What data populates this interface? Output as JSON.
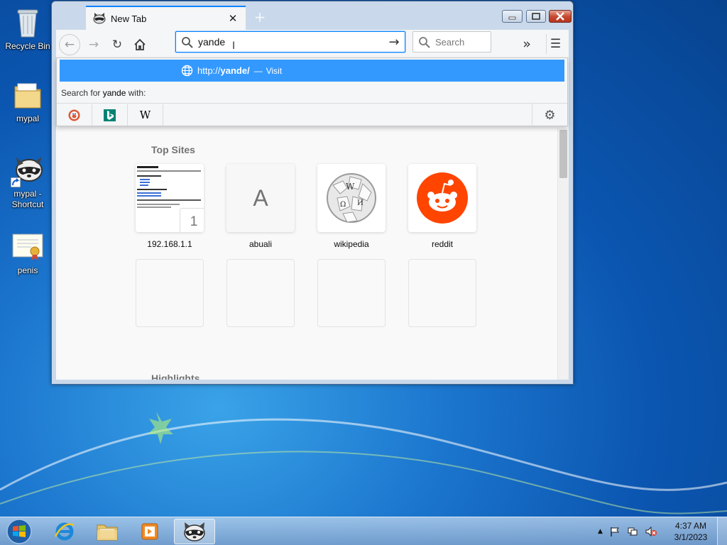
{
  "desktop": {
    "icons": [
      {
        "label": "Recycle Bin"
      },
      {
        "label": "mypal"
      },
      {
        "label": "mypal - Shortcut"
      },
      {
        "label": "penis"
      }
    ]
  },
  "browser": {
    "tab": {
      "title": "New Tab"
    },
    "urlbar": {
      "value": "yande"
    },
    "searchbar": {
      "placeholder": "Search"
    },
    "dropdown": {
      "suggestion": {
        "prefix": "http://",
        "host": "yande/",
        "separator": "—",
        "action": "Visit"
      },
      "search_for_prefix": "Search for ",
      "search_term": "yande",
      "search_for_suffix": " with:",
      "engines": [
        "duckduckgo-icon",
        "bing-icon",
        "wikipedia-icon"
      ]
    },
    "newtab": {
      "top_sites_title": "Top Sites",
      "top_sites": [
        {
          "label": "192.168.1.1",
          "badge": "1"
        },
        {
          "label": "abuali",
          "letter": "A"
        },
        {
          "label": "wikipedia"
        },
        {
          "label": "reddit"
        }
      ],
      "highlights_title": "Highlights"
    }
  },
  "taskbar": {
    "clock": {
      "time": "4:37 AM",
      "date": "3/1/2023"
    }
  }
}
